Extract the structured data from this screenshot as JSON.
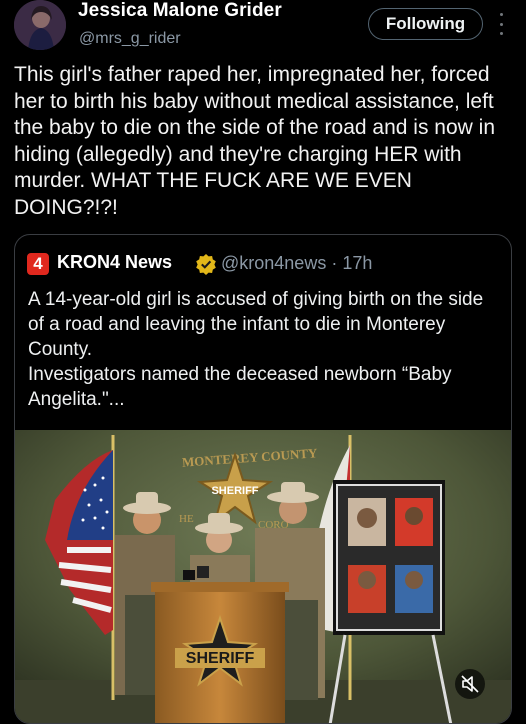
{
  "author": {
    "name": "Jessica Malone Grider",
    "handle": "@mrs_g_rider"
  },
  "follow_label": "Following",
  "post_text": "This girl's father raped her, impregnated her, forced her to birth his baby without medical assistance, left the baby to die on the side of the road and is now in hiding (allegedly) and they're charging HER with murder. WHAT THE FUCK ARE WE EVEN DOING?!?!",
  "quote": {
    "logo_text": "4",
    "name": "KRON4 News",
    "handle_time": "@kron4news · 17h",
    "text_1": "A 14-year-old girl is accused of giving birth on the side of a road and leaving the infant to die in Monterey County.",
    "text_2": "Investigators named the deceased newborn “Baby Angelita.\"...",
    "image": {
      "banner_text": "MONTEREY COUNTY",
      "wall_badge": "SHERIFF",
      "podium_badge": "SHERIFF",
      "wall_left_fragment": "HE",
      "wall_right_fragment": "CORO"
    }
  },
  "icons": {
    "more": "more-icon",
    "verified": "verified-badge-icon",
    "mute": "mute-icon"
  },
  "colors": {
    "background": "#000000",
    "secondary_text": "#8b98a5",
    "verified_gold": "#e2b719",
    "logo_red": "#e0281e"
  }
}
